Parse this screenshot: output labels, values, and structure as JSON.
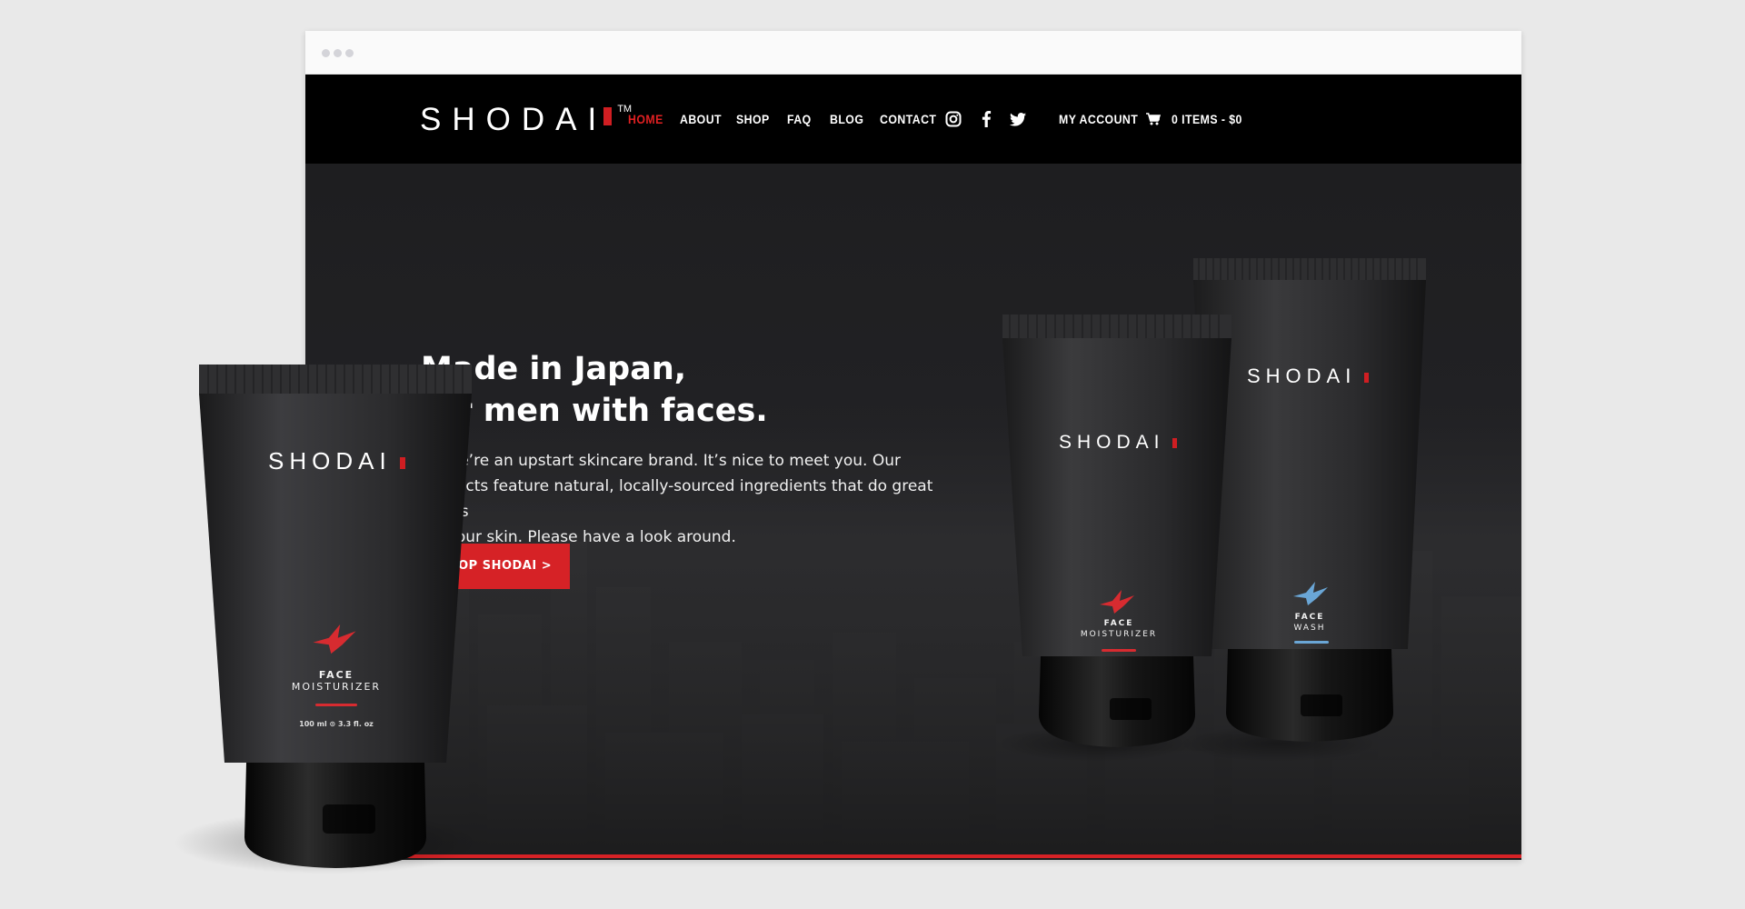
{
  "browser": {
    "dots": 3
  },
  "nav": {
    "logo": "SHODAI",
    "tm": "TM",
    "items": [
      {
        "label": "HOME",
        "active": true
      },
      {
        "label": "ABOUT",
        "active": false
      },
      {
        "label": "SHOP",
        "active": false
      },
      {
        "label": "FAQ",
        "active": false
      },
      {
        "label": "BLOG",
        "active": false
      },
      {
        "label": "CONTACT",
        "active": false
      }
    ],
    "social_icons": [
      "instagram-icon",
      "facebook-icon",
      "twitter-icon"
    ],
    "account": "MY ACCOUNT",
    "cart": "0 ITEMS - $0"
  },
  "hero": {
    "headline_line1": "Made in Japan,",
    "headline_line2": "for men with faces.",
    "intro_line1": "Hi, we’re an upstart skincare brand. It’s nice to meet you. Our",
    "intro_line2": "products feature natural, locally-sourced ingredients that do great things",
    "intro_line3": "for your skin. Please have a look around.",
    "cta": "SHOP SHODAI >"
  },
  "products": {
    "front": {
      "brand": "SHODAI",
      "line1": "FACE",
      "line2": "MOISTURIZER",
      "size": "100 ml ⊙ 3.3 fl. oz",
      "accent": "#d72b30"
    },
    "middle": {
      "brand": "SHODAI",
      "line1": "FACE",
      "line2": "MOISTURIZER",
      "accent": "#d72b30"
    },
    "back": {
      "brand": "SHODAI",
      "line1": "FACE",
      "line2": "WASH",
      "accent": "#6aa6d6"
    }
  },
  "colors": {
    "accent_red": "#d62226",
    "nav_bg": "#000000",
    "hero_bg": "#222225",
    "page_bg": "#e9e9e9"
  }
}
